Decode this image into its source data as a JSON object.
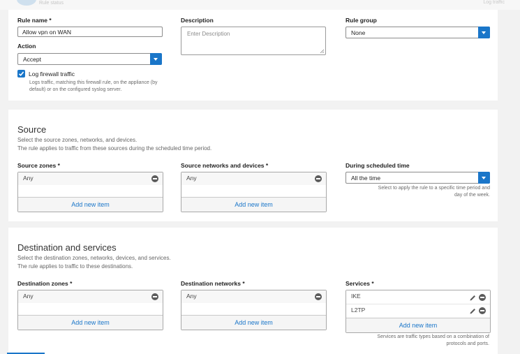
{
  "header": {
    "faded_label": "Rule status",
    "faded_right": "Log traffic"
  },
  "rule": {
    "name_label": "Rule name *",
    "name_value": "Allow vpn on WAN",
    "action_label": "Action",
    "action_value": "Accept",
    "log_label": "Log firewall traffic",
    "log_checked": true,
    "log_help_1": "Logs traffic, matching this firewall rule, on the appliance (by",
    "log_help_2": "default) or on the configured syslog server.",
    "description_label": "Description",
    "description_placeholder": "Enter Description",
    "group_label": "Rule group",
    "group_value": "None"
  },
  "source": {
    "title": "Source",
    "desc_1": "Select the source zones, networks, and devices.",
    "desc_2": "The rule applies to traffic from these sources during the scheduled time period.",
    "zones_label": "Source zones *",
    "zones_items": [
      "Any"
    ],
    "networks_label": "Source networks and devices *",
    "networks_items": [
      "Any"
    ],
    "add_label": "Add new item",
    "schedule_label": "During scheduled time",
    "schedule_value": "All the time",
    "schedule_help_1": "Select to apply the rule to a specific time period and",
    "schedule_help_2": "day of the week."
  },
  "destination": {
    "title": "Destination and services",
    "desc_1": "Select the destination zones, networks, devices, and services.",
    "desc_2": "The rule applies to traffic to these destinations.",
    "zones_label": "Destination zones *",
    "zones_items": [
      "Any"
    ],
    "networks_label": "Destination networks *",
    "networks_items": [
      "Any"
    ],
    "services_label": "Services *",
    "services_items": [
      "IKE",
      "L2TP"
    ],
    "add_label": "Add new item",
    "services_help_1": "Services are traffic types based on a combination of",
    "services_help_2": "protocols and ports."
  },
  "colors": {
    "accent": "#1a76c9",
    "background": "#f2f2f2",
    "card": "#ffffff"
  }
}
